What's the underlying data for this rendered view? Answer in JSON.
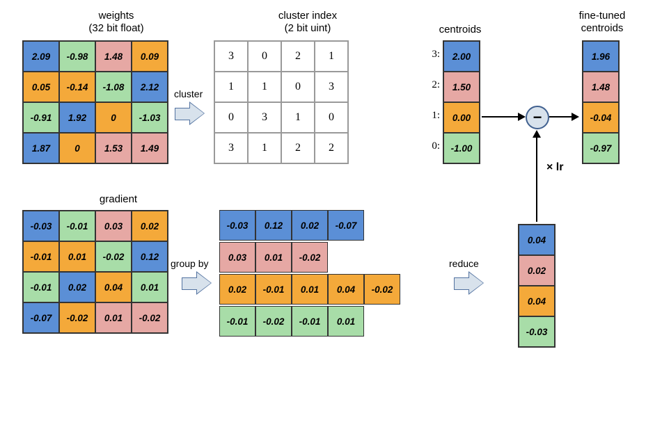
{
  "colors": {
    "blue": "#5b8fd6",
    "green": "#a8dda8",
    "pink": "#e6a8a4",
    "orange": "#f4a93a"
  },
  "titles": {
    "weights_l1": "weights",
    "weights_l2": "(32 bit float)",
    "cluster_idx_l1": "cluster index",
    "cluster_idx_l2": "(2 bit uint)",
    "centroids": "centroids",
    "finetuned_l1": "fine-tuned",
    "finetuned_l2": "centroids",
    "gradient": "gradient"
  },
  "arrows": {
    "cluster": "cluster",
    "group_by": "group by",
    "reduce": "reduce",
    "lr": "× lr"
  },
  "weights": {
    "rows": [
      [
        {
          "v": "2.09",
          "c": "blue"
        },
        {
          "v": "-0.98",
          "c": "green"
        },
        {
          "v": "1.48",
          "c": "pink"
        },
        {
          "v": "0.09",
          "c": "orange"
        }
      ],
      [
        {
          "v": "0.05",
          "c": "orange"
        },
        {
          "v": "-0.14",
          "c": "orange"
        },
        {
          "v": "-1.08",
          "c": "green"
        },
        {
          "v": "2.12",
          "c": "blue"
        }
      ],
      [
        {
          "v": "-0.91",
          "c": "green"
        },
        {
          "v": "1.92",
          "c": "blue"
        },
        {
          "v": "0",
          "c": "orange"
        },
        {
          "v": "-1.03",
          "c": "green"
        }
      ],
      [
        {
          "v": "1.87",
          "c": "blue"
        },
        {
          "v": "0",
          "c": "orange"
        },
        {
          "v": "1.53",
          "c": "pink"
        },
        {
          "v": "1.49",
          "c": "pink"
        }
      ]
    ]
  },
  "cluster_index": {
    "rows": [
      [
        "3",
        "0",
        "2",
        "1"
      ],
      [
        "1",
        "1",
        "0",
        "3"
      ],
      [
        "0",
        "3",
        "1",
        "0"
      ],
      [
        "3",
        "1",
        "2",
        "2"
      ]
    ]
  },
  "centroids": {
    "labels": [
      "3:",
      "2:",
      "1:",
      "0:"
    ],
    "cells": [
      {
        "v": "2.00",
        "c": "blue"
      },
      {
        "v": "1.50",
        "c": "pink"
      },
      {
        "v": "0.00",
        "c": "orange"
      },
      {
        "v": "-1.00",
        "c": "green"
      }
    ]
  },
  "finetuned": {
    "cells": [
      {
        "v": "1.96",
        "c": "blue"
      },
      {
        "v": "1.48",
        "c": "pink"
      },
      {
        "v": "-0.04",
        "c": "orange"
      },
      {
        "v": "-0.97",
        "c": "green"
      }
    ]
  },
  "gradient": {
    "rows": [
      [
        {
          "v": "-0.03",
          "c": "blue"
        },
        {
          "v": "-0.01",
          "c": "green"
        },
        {
          "v": "0.03",
          "c": "pink"
        },
        {
          "v": "0.02",
          "c": "orange"
        }
      ],
      [
        {
          "v": "-0.01",
          "c": "orange"
        },
        {
          "v": "0.01",
          "c": "orange"
        },
        {
          "v": "-0.02",
          "c": "green"
        },
        {
          "v": "0.12",
          "c": "blue"
        }
      ],
      [
        {
          "v": "-0.01",
          "c": "green"
        },
        {
          "v": "0.02",
          "c": "blue"
        },
        {
          "v": "0.04",
          "c": "orange"
        },
        {
          "v": "0.01",
          "c": "green"
        }
      ],
      [
        {
          "v": "-0.07",
          "c": "blue"
        },
        {
          "v": "-0.02",
          "c": "orange"
        },
        {
          "v": "0.01",
          "c": "pink"
        },
        {
          "v": "-0.02",
          "c": "pink"
        }
      ]
    ]
  },
  "grouped": {
    "rows": [
      {
        "c": "blue",
        "vals": [
          "-0.03",
          "0.12",
          "0.02",
          "-0.07"
        ]
      },
      {
        "c": "pink",
        "vals": [
          "0.03",
          "0.01",
          "-0.02"
        ]
      },
      {
        "c": "orange",
        "vals": [
          "0.02",
          "-0.01",
          "0.01",
          "0.04",
          "-0.02"
        ]
      },
      {
        "c": "green",
        "vals": [
          "-0.01",
          "-0.02",
          "-0.01",
          "0.01"
        ]
      }
    ]
  },
  "reduced": {
    "cells": [
      {
        "v": "0.04",
        "c": "blue"
      },
      {
        "v": "0.02",
        "c": "pink"
      },
      {
        "v": "0.04",
        "c": "orange"
      },
      {
        "v": "-0.03",
        "c": "green"
      }
    ]
  },
  "chart_data": {
    "type": "table",
    "description": "Weight-sharing quantization diagram: 4x4 weight matrix clustered by k-means into 4 centroids with 2-bit indices; gradients grouped by cluster, reduced (summed), multiplied by lr and subtracted from centroids to produce fine-tuned centroids.",
    "weights_32bit_float": [
      [
        2.09,
        -0.98,
        1.48,
        0.09
      ],
      [
        0.05,
        -0.14,
        -1.08,
        2.12
      ],
      [
        -0.91,
        1.92,
        0,
        -1.03
      ],
      [
        1.87,
        0,
        1.53,
        1.49
      ]
    ],
    "cluster_index_2bit_uint": [
      [
        3,
        0,
        2,
        1
      ],
      [
        1,
        1,
        0,
        3
      ],
      [
        0,
        3,
        1,
        0
      ],
      [
        3,
        1,
        2,
        2
      ]
    ],
    "centroids": {
      "3": 2.0,
      "2": 1.5,
      "1": 0.0,
      "0": -1.0
    },
    "gradient": [
      [
        -0.03,
        -0.01,
        0.03,
        0.02
      ],
      [
        -0.01,
        0.01,
        -0.02,
        0.12
      ],
      [
        -0.01,
        0.02,
        0.04,
        0.01
      ],
      [
        -0.07,
        -0.02,
        0.01,
        -0.02
      ]
    ],
    "grouped_by_cluster": {
      "3_blue": [
        -0.03,
        0.12,
        0.02,
        -0.07
      ],
      "2_pink": [
        0.03,
        0.01,
        -0.02
      ],
      "1_orange": [
        0.02,
        -0.01,
        0.01,
        0.04,
        -0.02
      ],
      "0_green": [
        -0.01,
        -0.02,
        -0.01,
        0.01
      ]
    },
    "reduced_sum": {
      "3": 0.04,
      "2": 0.02,
      "1": 0.04,
      "0": -0.03
    },
    "fine_tuned_centroids": {
      "3": 1.96,
      "2": 1.48,
      "1": -0.04,
      "0": -0.97
    },
    "update_rule": "fine_tuned = centroid - lr * reduced"
  }
}
